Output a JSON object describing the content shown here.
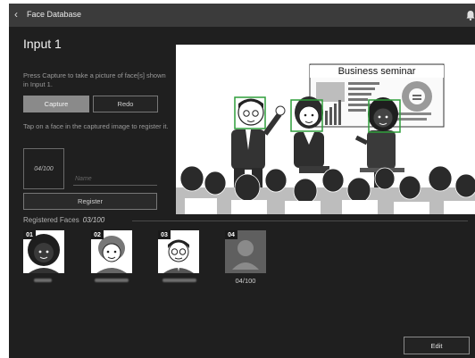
{
  "header": {
    "back_icon": "chevron-left-icon",
    "title": "Face Database",
    "notification_icon": "bell-icon"
  },
  "page": {
    "heading": "Input 1"
  },
  "capture_panel": {
    "instruction": "Press Capture to take a picture of face[s] shown in Input 1.",
    "capture_label": "Capture",
    "redo_label": "Redo",
    "tap_instruction": "Tap on a face in the captured image to register it."
  },
  "register_form": {
    "face_count": "04/100",
    "name_placeholder": "Name",
    "name_value": "",
    "register_label": "Register"
  },
  "captured_image": {
    "sign_text": "Business seminar"
  },
  "registered": {
    "label": "Registered Faces",
    "count": "03/100",
    "faces": [
      {
        "number": "01",
        "name_blurred": true
      },
      {
        "number": "02",
        "name_blurred": true
      },
      {
        "number": "03",
        "name_blurred": true
      },
      {
        "number": "04",
        "placeholder": true,
        "count": "04/100"
      }
    ]
  },
  "footer": {
    "edit_label": "Edit"
  },
  "colors": {
    "background": "#1f1f1f",
    "header": "#3b3b3b",
    "capture_button": "#8a8a8a",
    "face_highlight": "#2e9e3a"
  }
}
